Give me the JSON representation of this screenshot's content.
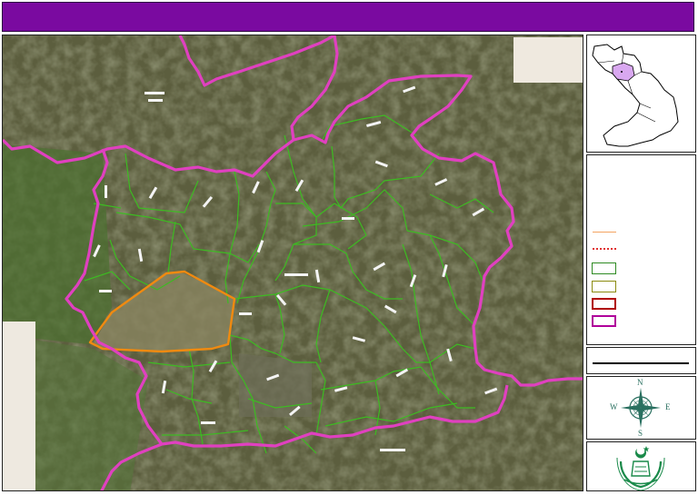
{
  "title": "",
  "compass": {
    "n": "N",
    "s": "S",
    "e": "E",
    "w": "W"
  },
  "legend": {
    "items": [
      {
        "kind": "line",
        "color": "#f4a460",
        "style": "solid"
      },
      {
        "kind": "line",
        "color": "#e03030",
        "style": "dotted"
      },
      {
        "kind": "box",
        "color": "#2e8b22"
      },
      {
        "kind": "box",
        "color": "#8b8b10"
      },
      {
        "kind": "box",
        "color": "#b00000"
      },
      {
        "kind": "box",
        "color": "#b0009a"
      }
    ]
  },
  "colors": {
    "title_bar": "#7a0aa0",
    "district_boundary": "#e040c0",
    "union_council_boundary": "#3dbb22",
    "urban_boundary": "#f08a10",
    "inset_highlight": "#d9a8f0"
  }
}
